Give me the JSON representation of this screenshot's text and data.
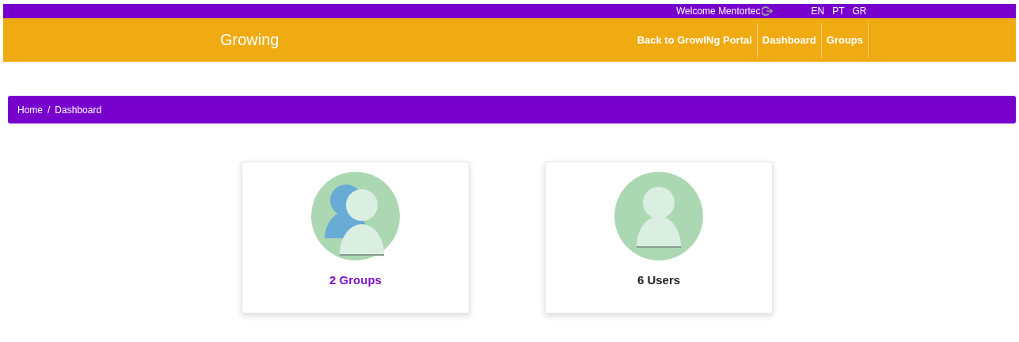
{
  "top_bar": {
    "welcome": "Welcome Mentortec",
    "languages": [
      {
        "label": "EN"
      },
      {
        "label": "PT"
      },
      {
        "label": "GR"
      }
    ]
  },
  "header": {
    "logo": "Growing",
    "nav": [
      {
        "label": "Back to GrowINg Portal"
      },
      {
        "label": "Dashboard"
      },
      {
        "label": "Groups"
      }
    ]
  },
  "breadcrumb": {
    "separator": "/",
    "items": [
      {
        "label": "Home"
      },
      {
        "label": "Dashboard"
      }
    ]
  },
  "cards": [
    {
      "kind": "group",
      "label": "2 Groups"
    },
    {
      "kind": "user",
      "label": "6 Users"
    }
  ]
}
